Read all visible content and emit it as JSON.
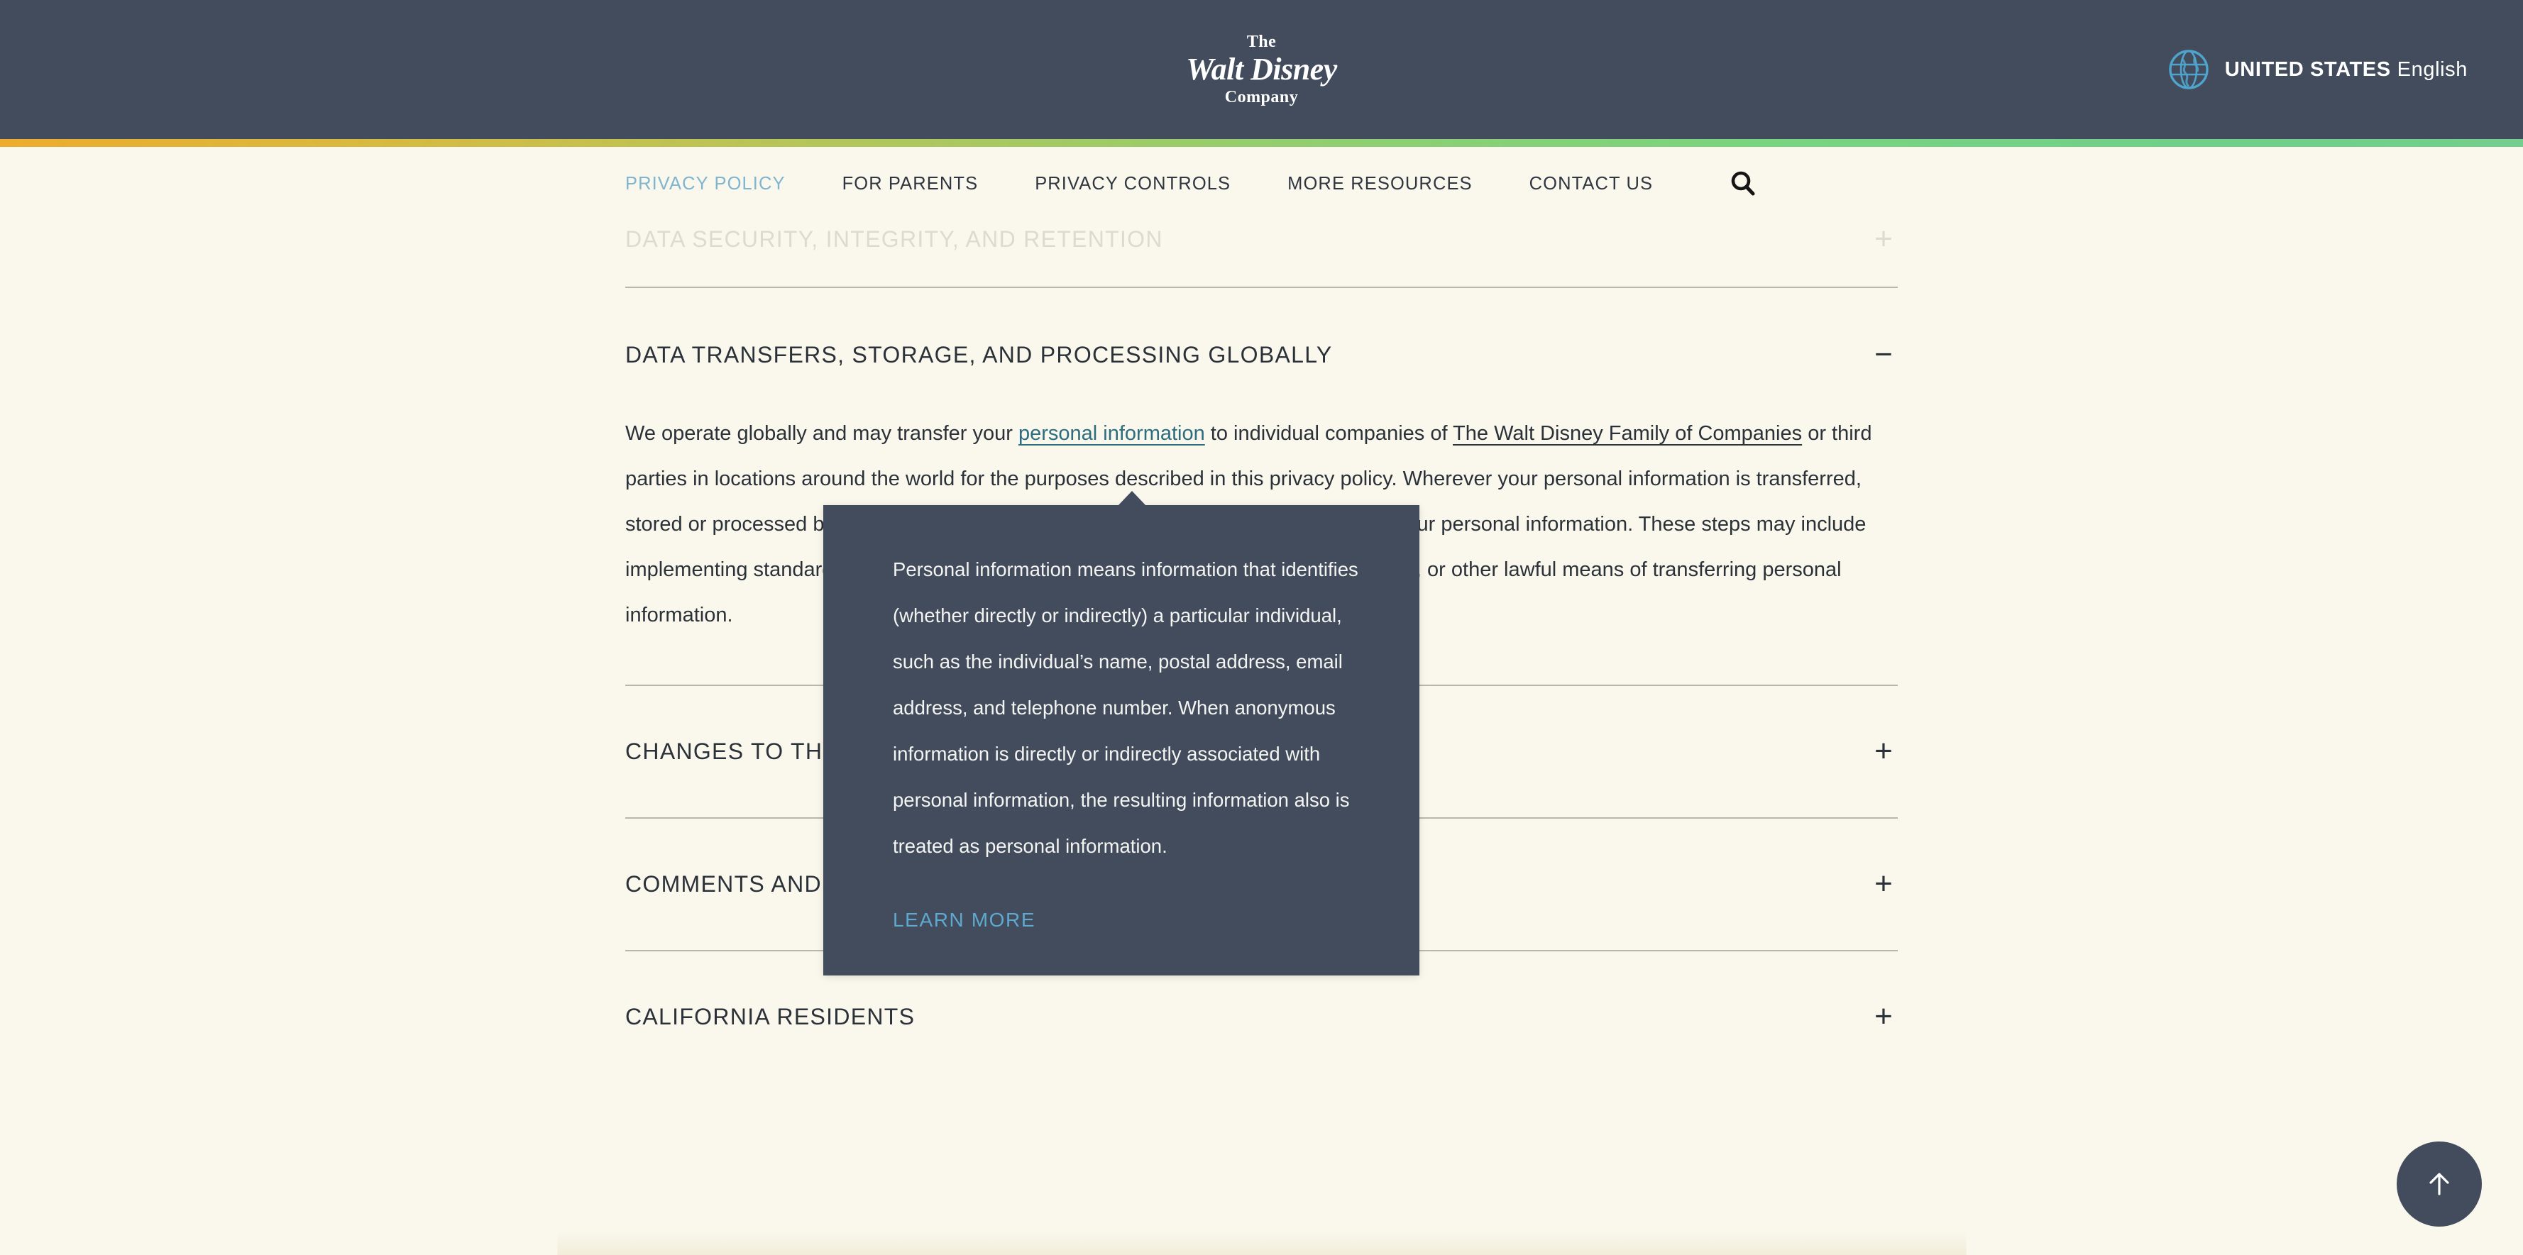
{
  "header": {
    "brand": {
      "line1": "The",
      "line2": "Walt Disney",
      "line3": "Company",
      "icon": "disney-logo"
    },
    "language_selector": {
      "icon": "globe-icon",
      "country": "UNITED STATES",
      "language": "English"
    },
    "background_color": "#424c5c",
    "accent_gradient_start": "#eeac2c",
    "accent_gradient_end": "#72cf8d"
  },
  "nav": {
    "items": [
      {
        "label": "PRIVACY POLICY",
        "active": true
      },
      {
        "label": "FOR PARENTS",
        "active": false
      },
      {
        "label": "PRIVACY CONTROLS",
        "active": false
      },
      {
        "label": "MORE RESOURCES",
        "active": false
      },
      {
        "label": "CONTACT US",
        "active": false
      }
    ],
    "search_icon": "search-icon",
    "active_color": "#7fb5cf"
  },
  "sections": {
    "faded": {
      "title": "DATA SECURITY, INTEGRITY, AND RETENTION",
      "sign": "+"
    },
    "open": {
      "title": "DATA TRANSFERS, STORAGE, AND PROCESSING GLOBALLY",
      "sign": "−",
      "paragraph": {
        "p1": "We operate globally and may transfer your ",
        "link1": "personal information",
        "p2": " to individual companies of ",
        "link2": "The Walt Disney Family of Companies",
        "p3": " or third parties in locations around the world for the purposes described in this privacy policy. Wherever your personal information is transferred, stored or processed by us, we will take reasonable steps to safeguard the privacy of your personal information. These steps may include implementing standard contractual clauses as approved by law, obtaining your consent, or other lawful means of transferring personal information."
      }
    },
    "collapsed": [
      {
        "title": "CHANGES TO THIS PRIVACY POLICY",
        "sign": "+"
      },
      {
        "title": "COMMENTS AND QUESTIONS",
        "sign": "+"
      },
      {
        "title": "CALIFORNIA RESIDENTS",
        "sign": "+"
      }
    ]
  },
  "tooltip": {
    "body": "Personal information means information that identifies (whether directly or indirectly) a particular individual, such as the individual’s name, postal address, email address, and telephone number. When anonymous information is directly or indirectly associated with personal information, the resulting information also is treated as personal information.",
    "cta": "LEARN MORE",
    "background_color": "#424c5c",
    "cta_color": "#5ea9ce"
  },
  "scroll_top": {
    "icon": "arrow-up-icon",
    "background_color": "#424c5c"
  },
  "page": {
    "background_color": "#faf7ec",
    "text_color": "#2b3138"
  }
}
